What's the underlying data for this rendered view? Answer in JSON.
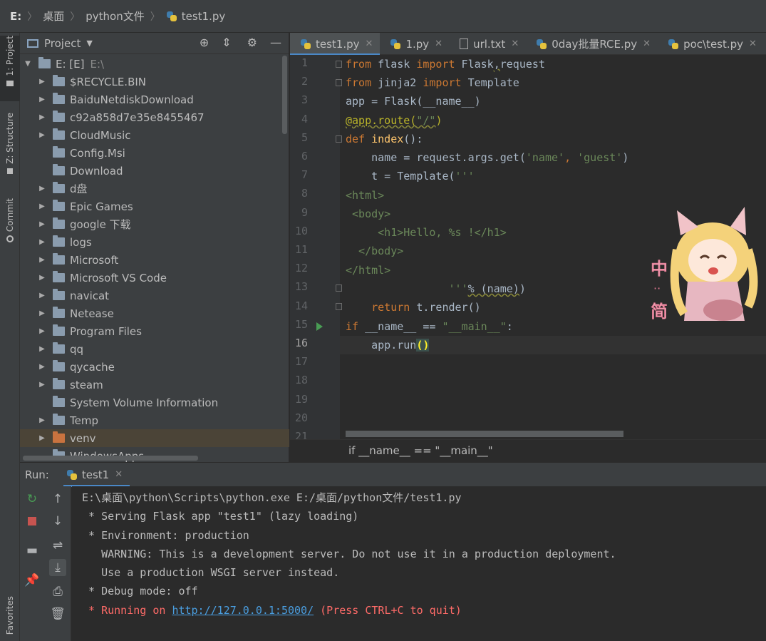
{
  "breadcrumb": {
    "drive": "E:",
    "items": [
      "桌面",
      "python文件",
      "test1.py"
    ]
  },
  "left_strip": {
    "project": "1: Project",
    "structure": "Z: Structure",
    "commit": "Commit",
    "favorites": "Favorites"
  },
  "project_panel": {
    "title": "Project",
    "root_label": "E: [E]",
    "root_path": "E:\\",
    "items": [
      {
        "label": "$RECYCLE.BIN",
        "expandable": true
      },
      {
        "label": "BaiduNetdiskDownload",
        "expandable": true
      },
      {
        "label": "c92a858d7e35e8455467",
        "expandable": true
      },
      {
        "label": "CloudMusic",
        "expandable": true
      },
      {
        "label": "Config.Msi",
        "expandable": false
      },
      {
        "label": "Download",
        "expandable": false
      },
      {
        "label": "d盘",
        "expandable": true
      },
      {
        "label": "Epic Games",
        "expandable": true
      },
      {
        "label": "google 下载",
        "expandable": true
      },
      {
        "label": "logs",
        "expandable": true
      },
      {
        "label": "Microsoft",
        "expandable": true
      },
      {
        "label": "Microsoft VS Code",
        "expandable": true
      },
      {
        "label": "navicat",
        "expandable": true
      },
      {
        "label": "Netease",
        "expandable": true
      },
      {
        "label": "Program Files",
        "expandable": true
      },
      {
        "label": "qq",
        "expandable": true
      },
      {
        "label": "qycache",
        "expandable": true
      },
      {
        "label": "steam",
        "expandable": true
      },
      {
        "label": "System Volume Information",
        "expandable": false
      },
      {
        "label": "Temp",
        "expandable": true
      },
      {
        "label": "venv",
        "expandable": true
      },
      {
        "label": "WindowsApps",
        "expandable": false
      }
    ]
  },
  "editor_tabs": [
    {
      "label": "test1.py",
      "active": true,
      "icon": "python-icon"
    },
    {
      "label": "1.py",
      "active": false,
      "icon": "python-icon"
    },
    {
      "label": "url.txt",
      "active": false,
      "icon": "text-file-icon"
    },
    {
      "label": "0day批量RCE.py",
      "active": false,
      "icon": "python-icon"
    },
    {
      "label": "poc\\test.py",
      "active": false,
      "icon": "python-icon"
    }
  ],
  "editor": {
    "line_numbers": [
      "1",
      "2",
      "3",
      "4",
      "5",
      "6",
      "7",
      "8",
      "9",
      "10",
      "11",
      "12",
      "13",
      "14",
      "15",
      "16",
      "17",
      "18",
      "19",
      "20",
      "21"
    ],
    "current_line": "16",
    "code": {
      "l1": [
        "from",
        " flask ",
        "import",
        " Flask",
        ",",
        "request"
      ],
      "l2": [
        "from",
        " jinja2 ",
        "import",
        " Template"
      ],
      "l3": "app = Flask(__name__)",
      "l4": [
        "@app.route(",
        "\"/\"",
        ")"
      ],
      "l5": [
        "def",
        " ",
        "index",
        "():"
      ],
      "l6": [
        "    name = request.args.get(",
        "'name'",
        ", ",
        "'guest'",
        ")"
      ],
      "l7": [
        "    t = Template(",
        "'''"
      ],
      "l8": "<html>",
      "l9": " <body>",
      "l10": "     <h1>Hello, %s !</h1>",
      "l11": "  </body>",
      "l12": "</html>",
      "l13": [
        "                '''",
        "% ",
        "(name)",
        ")"
      ],
      "l14": [
        "    ",
        "return",
        " t.render()"
      ],
      "l15": [
        "if",
        " __name__ == ",
        "\"__main__\"",
        ":"
      ],
      "l16": [
        "    app.run",
        "()"
      ]
    },
    "structure_breadcrumb": "if __name__ == \"__main__\""
  },
  "run_panel": {
    "label": "Run:",
    "tab_label": "test1",
    "console": {
      "line1": "E:\\桌面\\python\\Scripts\\python.exe E:/桌面/python文件/test1.py",
      "line2": " * Serving Flask app \"test1\" (lazy loading)",
      "line3": " * Environment: production",
      "line4": "   WARNING: This is a development server. Do not use it in a production deployment.",
      "line5": "   Use a production WSGI server instead.",
      "line6": " * Debug mode: off",
      "line7_prefix": " * Running on ",
      "line7_link": "http://127.0.0.1:5000/",
      "line7_suffix": " (Press CTRL+C to quit)"
    }
  },
  "sticker": {
    "text": "中简"
  },
  "colors": {
    "keyword": "#cc7832",
    "string": "#6a8759",
    "function": "#ffc66d",
    "decorator": "#bbb529",
    "accent": "#4a88c7",
    "error": "#ff6b68"
  }
}
